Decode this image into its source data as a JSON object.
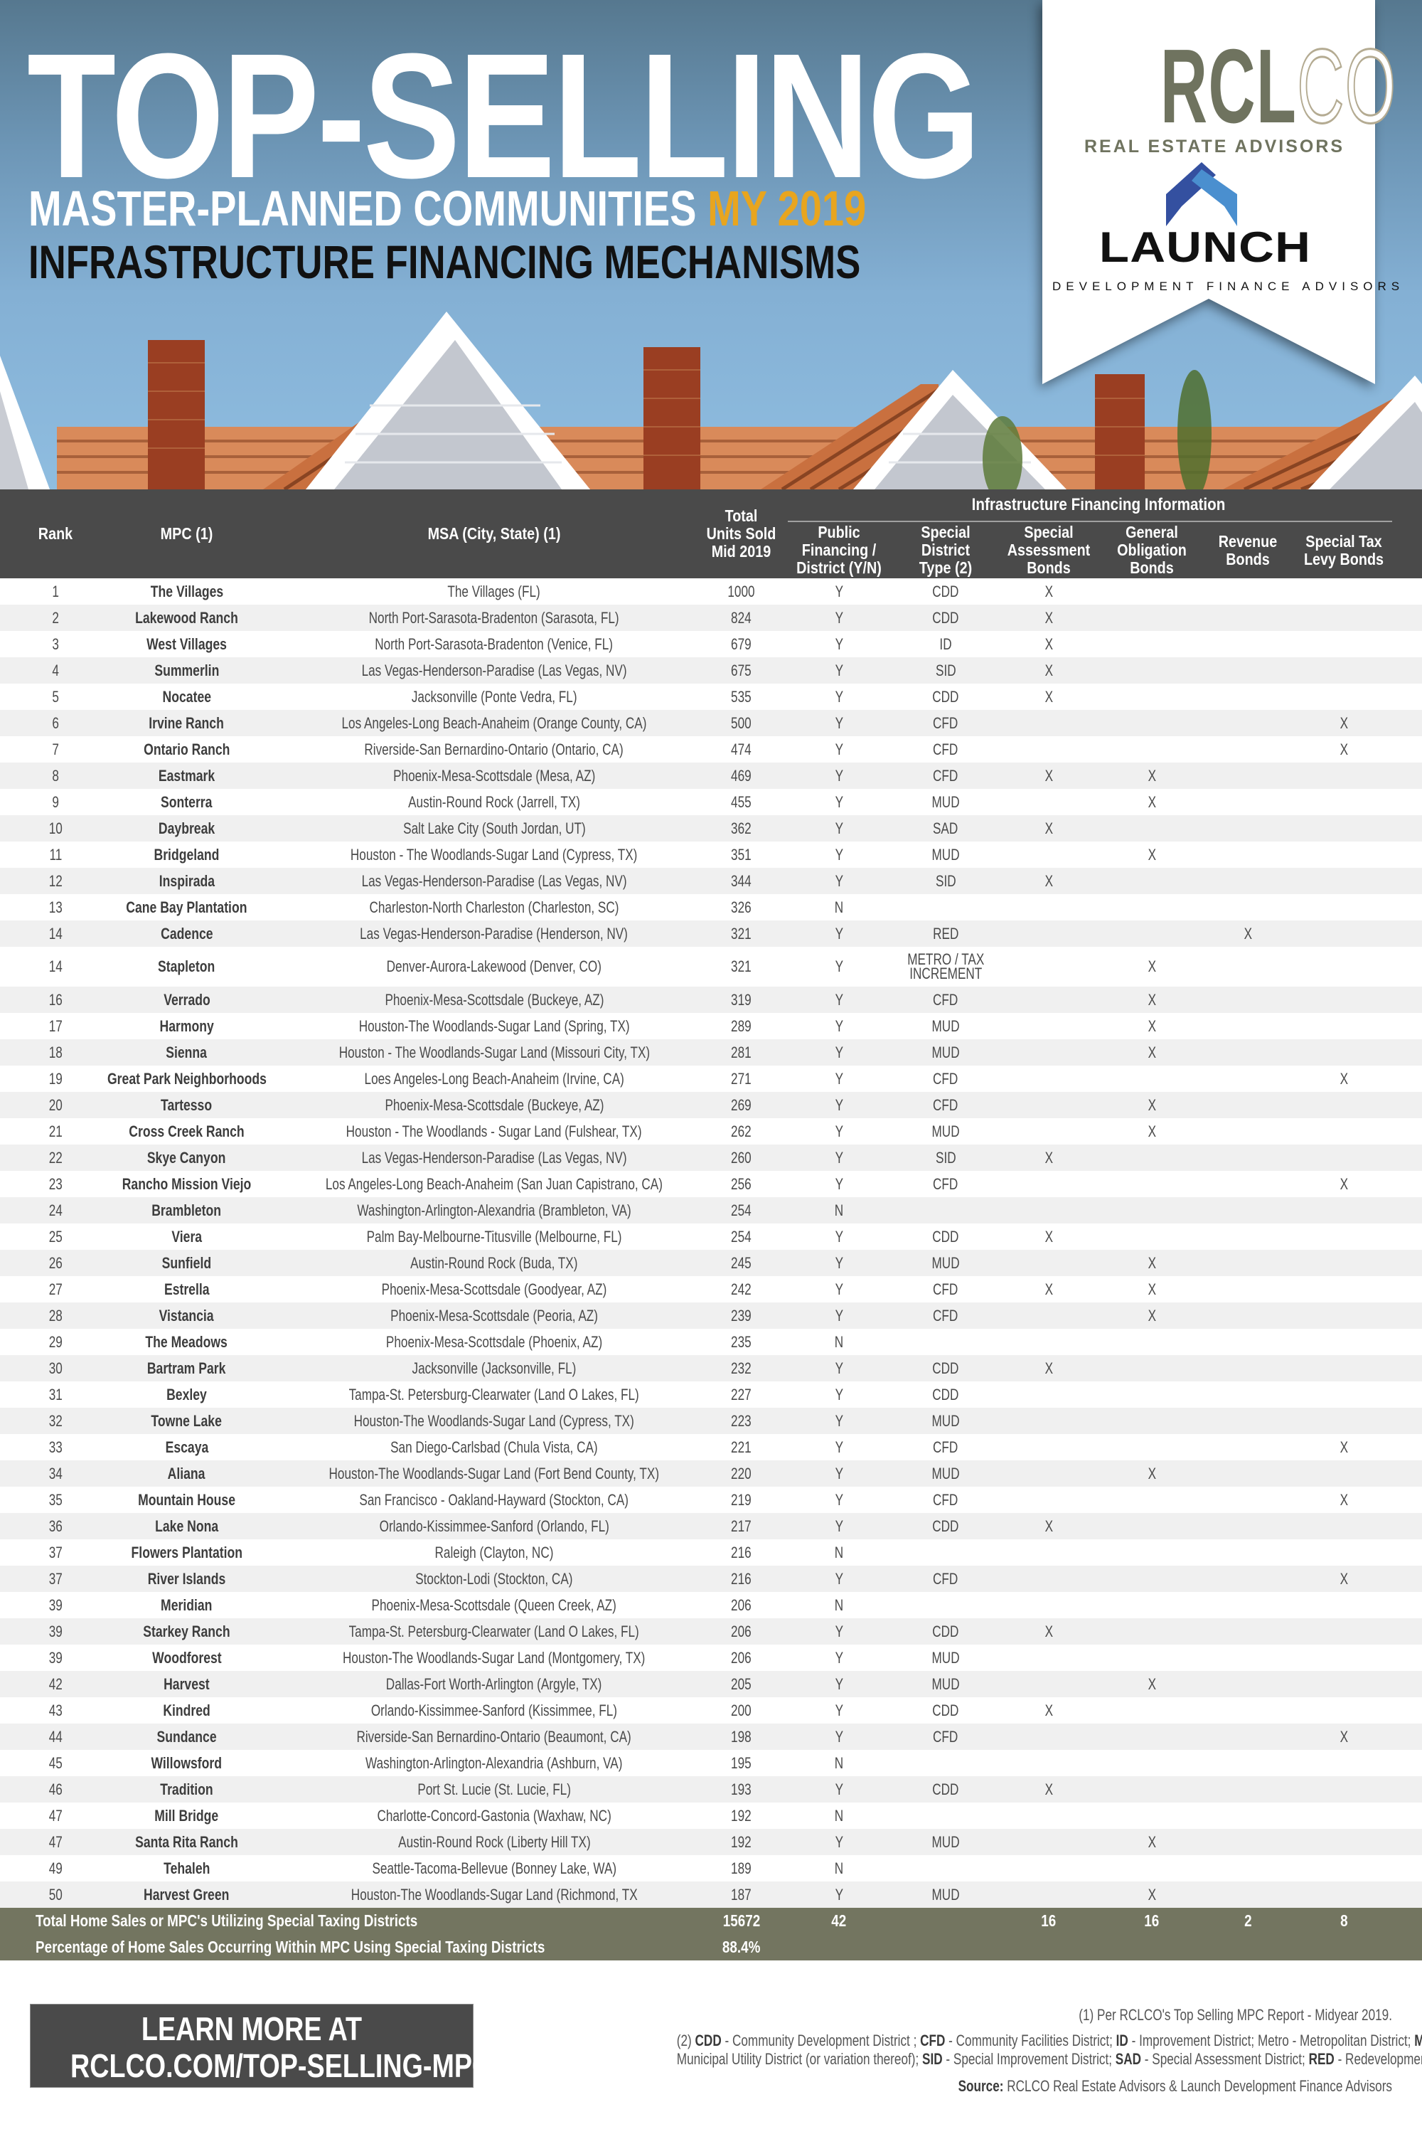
{
  "header": {
    "title": "TOP-SELLING",
    "subtitle": "MASTER-PLANNED COMMUNITIES",
    "subtitle_accent": "MY 2019",
    "subtitle2": "INFRASTRUCTURE FINANCING MECHANISMS",
    "accent_color": "#e8a51f"
  },
  "logos": {
    "rclco_solid": "RCL",
    "rclco_outline": "CO",
    "rclco_tagline": "REAL ESTATE ADVISORS",
    "launch_name": "LAUNCH",
    "launch_tagline": "DEVELOPMENT FINANCE ADVISORS"
  },
  "table": {
    "group_header": "Infrastructure Financing Information",
    "columns": {
      "rank": "Rank",
      "mpc": "MPC (1)",
      "msa": "MSA (City, State) (1)",
      "units": "Total\nUnits Sold\nMid 2019",
      "public": "Public\nFinancing /\nDistrict (Y/N)",
      "type": "Special\nDistrict\nType (2)",
      "sab": "Special\nAssessment\nBonds",
      "gob": "General\nObligation\nBonds",
      "rev": "Revenue\nBonds",
      "stl": "Special Tax\nLevy Bonds"
    },
    "rows": [
      {
        "rank": "1",
        "mpc": "The Villages",
        "msa": "The Villages (FL)",
        "units": "1000",
        "public": "Y",
        "type": "CDD",
        "sab": "X",
        "gob": "",
        "rev": "",
        "stl": ""
      },
      {
        "rank": "2",
        "mpc": "Lakewood Ranch",
        "msa": "North Port-Sarasota-Bradenton (Sarasota, FL)",
        "units": "824",
        "public": "Y",
        "type": "CDD",
        "sab": "X",
        "gob": "",
        "rev": "",
        "stl": ""
      },
      {
        "rank": "3",
        "mpc": "West Villages",
        "msa": "North Port-Sarasota-Bradenton (Venice, FL)",
        "units": "679",
        "public": "Y",
        "type": "ID",
        "sab": "X",
        "gob": "",
        "rev": "",
        "stl": ""
      },
      {
        "rank": "4",
        "mpc": "Summerlin",
        "msa": "Las Vegas-Henderson-Paradise (Las Vegas, NV)",
        "units": "675",
        "public": "Y",
        "type": "SID",
        "sab": "X",
        "gob": "",
        "rev": "",
        "stl": ""
      },
      {
        "rank": "5",
        "mpc": "Nocatee",
        "msa": "Jacksonville (Ponte Vedra, FL)",
        "units": "535",
        "public": "Y",
        "type": "CDD",
        "sab": "X",
        "gob": "",
        "rev": "",
        "stl": ""
      },
      {
        "rank": "6",
        "mpc": "Irvine Ranch",
        "msa": "Los Angeles-Long Beach-Anaheim (Orange County, CA)",
        "units": "500",
        "public": "Y",
        "type": "CFD",
        "sab": "",
        "gob": "",
        "rev": "",
        "stl": "X"
      },
      {
        "rank": "7",
        "mpc": "Ontario Ranch",
        "msa": "Riverside-San Bernardino-Ontario (Ontario, CA)",
        "units": "474",
        "public": "Y",
        "type": "CFD",
        "sab": "",
        "gob": "",
        "rev": "",
        "stl": "X"
      },
      {
        "rank": "8",
        "mpc": "Eastmark",
        "msa": "Phoenix-Mesa-Scottsdale (Mesa, AZ)",
        "units": "469",
        "public": "Y",
        "type": "CFD",
        "sab": "X",
        "gob": "X",
        "rev": "",
        "stl": ""
      },
      {
        "rank": "9",
        "mpc": "Sonterra",
        "msa": "Austin-Round Rock (Jarrell, TX)",
        "units": "455",
        "public": "Y",
        "type": "MUD",
        "sab": "",
        "gob": "X",
        "rev": "",
        "stl": ""
      },
      {
        "rank": "10",
        "mpc": "Daybreak",
        "msa": "Salt Lake City (South Jordan, UT)",
        "units": "362",
        "public": "Y",
        "type": "SAD",
        "sab": "X",
        "gob": "",
        "rev": "",
        "stl": ""
      },
      {
        "rank": "11",
        "mpc": "Bridgeland",
        "msa": "Houston - The Woodlands-Sugar Land (Cypress, TX)",
        "units": "351",
        "public": "Y",
        "type": "MUD",
        "sab": "",
        "gob": "X",
        "rev": "",
        "stl": ""
      },
      {
        "rank": "12",
        "mpc": "Inspirada",
        "msa": "Las Vegas-Henderson-Paradise (Las Vegas, NV)",
        "units": "344",
        "public": "Y",
        "type": "SID",
        "sab": "X",
        "gob": "",
        "rev": "",
        "stl": ""
      },
      {
        "rank": "13",
        "mpc": "Cane Bay Plantation",
        "msa": "Charleston-North Charleston (Charleston, SC)",
        "units": "326",
        "public": "N",
        "type": "",
        "sab": "",
        "gob": "",
        "rev": "",
        "stl": ""
      },
      {
        "rank": "14",
        "mpc": "Cadence",
        "msa": "Las Vegas-Henderson-Paradise (Henderson, NV)",
        "units": "321",
        "public": "Y",
        "type": "RED",
        "sab": "",
        "gob": "",
        "rev": "X",
        "stl": ""
      },
      {
        "rank": "14",
        "mpc": "Stapleton",
        "msa": "Denver-Aurora-Lakewood (Denver, CO)",
        "units": "321",
        "public": "Y",
        "type": "METRO / TAX\nINCREMENT",
        "sab": "",
        "gob": "X",
        "rev": "",
        "stl": ""
      },
      {
        "rank": "16",
        "mpc": "Verrado",
        "msa": "Phoenix-Mesa-Scottsdale (Buckeye, AZ)",
        "units": "319",
        "public": "Y",
        "type": "CFD",
        "sab": "",
        "gob": "X",
        "rev": "",
        "stl": ""
      },
      {
        "rank": "17",
        "mpc": "Harmony",
        "msa": "Houston-The Woodlands-Sugar Land (Spring, TX)",
        "units": "289",
        "public": "Y",
        "type": "MUD",
        "sab": "",
        "gob": "X",
        "rev": "",
        "stl": ""
      },
      {
        "rank": "18",
        "mpc": "Sienna",
        "msa": "Houston - The Woodlands-Sugar Land (Missouri City, TX)",
        "units": "281",
        "public": "Y",
        "type": "MUD",
        "sab": "",
        "gob": "X",
        "rev": "",
        "stl": ""
      },
      {
        "rank": "19",
        "mpc": "Great Park Neighborhoods",
        "msa": "Loes Angeles-Long Beach-Anaheim (Irvine, CA)",
        "units": "271",
        "public": "Y",
        "type": "CFD",
        "sab": "",
        "gob": "",
        "rev": "",
        "stl": "X"
      },
      {
        "rank": "20",
        "mpc": "Tartesso",
        "msa": "Phoenix-Mesa-Scottsdale (Buckeye, AZ)",
        "units": "269",
        "public": "Y",
        "type": "CFD",
        "sab": "",
        "gob": "X",
        "rev": "",
        "stl": ""
      },
      {
        "rank": "21",
        "mpc": "Cross Creek Ranch",
        "msa": "Houston - The Woodlands - Sugar Land (Fulshear, TX)",
        "units": "262",
        "public": "Y",
        "type": "MUD",
        "sab": "",
        "gob": "X",
        "rev": "",
        "stl": ""
      },
      {
        "rank": "22",
        "mpc": "Skye Canyon",
        "msa": "Las Vegas-Henderson-Paradise (Las Vegas, NV)",
        "units": "260",
        "public": "Y",
        "type": "SID",
        "sab": "X",
        "gob": "",
        "rev": "",
        "stl": ""
      },
      {
        "rank": "23",
        "mpc": "Rancho Mission Viejo",
        "msa": "Los Angeles-Long Beach-Anaheim (San Juan Capistrano, CA)",
        "units": "256",
        "public": "Y",
        "type": "CFD",
        "sab": "",
        "gob": "",
        "rev": "",
        "stl": "X"
      },
      {
        "rank": "24",
        "mpc": "Brambleton",
        "msa": "Washington-Arlington-Alexandria (Brambleton, VA)",
        "units": "254",
        "public": "N",
        "type": "",
        "sab": "",
        "gob": "",
        "rev": "",
        "stl": ""
      },
      {
        "rank": "25",
        "mpc": "Viera",
        "msa": "Palm Bay-Melbourne-Titusville (Melbourne, FL)",
        "units": "254",
        "public": "Y",
        "type": "CDD",
        "sab": "X",
        "gob": "",
        "rev": "",
        "stl": ""
      },
      {
        "rank": "26",
        "mpc": "Sunfield",
        "msa": "Austin-Round Rock (Buda, TX)",
        "units": "245",
        "public": "Y",
        "type": "MUD",
        "sab": "",
        "gob": "X",
        "rev": "",
        "stl": ""
      },
      {
        "rank": "27",
        "mpc": "Estrella",
        "msa": "Phoenix-Mesa-Scottsdale (Goodyear, AZ)",
        "units": "242",
        "public": "Y",
        "type": "CFD",
        "sab": "X",
        "gob": "X",
        "rev": "",
        "stl": ""
      },
      {
        "rank": "28",
        "mpc": "Vistancia",
        "msa": "Phoenix-Mesa-Scottsdale (Peoria, AZ)",
        "units": "239",
        "public": "Y",
        "type": "CFD",
        "sab": "",
        "gob": "X",
        "rev": "",
        "stl": ""
      },
      {
        "rank": "29",
        "mpc": "The Meadows",
        "msa": "Phoenix-Mesa-Scottsdale (Phoenix, AZ)",
        "units": "235",
        "public": "N",
        "type": "",
        "sab": "",
        "gob": "",
        "rev": "",
        "stl": ""
      },
      {
        "rank": "30",
        "mpc": "Bartram Park",
        "msa": "Jacksonville (Jacksonville, FL)",
        "units": "232",
        "public": "Y",
        "type": "CDD",
        "sab": "X",
        "gob": "",
        "rev": "",
        "stl": ""
      },
      {
        "rank": "31",
        "mpc": "Bexley",
        "msa": "Tampa-St. Petersburg-Clearwater (Land O Lakes, FL)",
        "units": "227",
        "public": "Y",
        "type": "CDD",
        "sab": "",
        "gob": "",
        "rev": "",
        "stl": ""
      },
      {
        "rank": "32",
        "mpc": "Towne Lake",
        "msa": "Houston-The Woodlands-Sugar Land (Cypress, TX)",
        "units": "223",
        "public": "Y",
        "type": "MUD",
        "sab": "",
        "gob": "",
        "rev": "",
        "stl": ""
      },
      {
        "rank": "33",
        "mpc": "Escaya",
        "msa": "San Diego-Carlsbad (Chula Vista, CA)",
        "units": "221",
        "public": "Y",
        "type": "CFD",
        "sab": "",
        "gob": "",
        "rev": "",
        "stl": "X"
      },
      {
        "rank": "34",
        "mpc": "Aliana",
        "msa": "Houston-The Woodlands-Sugar Land (Fort Bend County, TX)",
        "units": "220",
        "public": "Y",
        "type": "MUD",
        "sab": "",
        "gob": "X",
        "rev": "",
        "stl": ""
      },
      {
        "rank": "35",
        "mpc": "Mountain House",
        "msa": "San Francisco - Oakland-Hayward (Stockton, CA)",
        "units": "219",
        "public": "Y",
        "type": "CFD",
        "sab": "",
        "gob": "",
        "rev": "",
        "stl": "X"
      },
      {
        "rank": "36",
        "mpc": "Lake Nona",
        "msa": "Orlando-Kissimmee-Sanford (Orlando, FL)",
        "units": "217",
        "public": "Y",
        "type": "CDD",
        "sab": "X",
        "gob": "",
        "rev": "",
        "stl": ""
      },
      {
        "rank": "37",
        "mpc": "Flowers Plantation",
        "msa": "Raleigh (Clayton, NC)",
        "units": "216",
        "public": "N",
        "type": "",
        "sab": "",
        "gob": "",
        "rev": "",
        "stl": ""
      },
      {
        "rank": "37",
        "mpc": "River Islands",
        "msa": "Stockton-Lodi (Stockton, CA)",
        "units": "216",
        "public": "Y",
        "type": "CFD",
        "sab": "",
        "gob": "",
        "rev": "",
        "stl": "X"
      },
      {
        "rank": "39",
        "mpc": "Meridian",
        "msa": "Phoenix-Mesa-Scottsdale (Queen Creek, AZ)",
        "units": "206",
        "public": "N",
        "type": "",
        "sab": "",
        "gob": "",
        "rev": "",
        "stl": ""
      },
      {
        "rank": "39",
        "mpc": "Starkey Ranch",
        "msa": "Tampa-St. Petersburg-Clearwater (Land O Lakes, FL)",
        "units": "206",
        "public": "Y",
        "type": "CDD",
        "sab": "X",
        "gob": "",
        "rev": "",
        "stl": ""
      },
      {
        "rank": "39",
        "mpc": "Woodforest",
        "msa": "Houston-The Woodlands-Sugar Land (Montgomery, TX)",
        "units": "206",
        "public": "Y",
        "type": "MUD",
        "sab": "",
        "gob": "",
        "rev": "",
        "stl": ""
      },
      {
        "rank": "42",
        "mpc": "Harvest",
        "msa": "Dallas-Fort Worth-Arlington (Argyle, TX)",
        "units": "205",
        "public": "Y",
        "type": "MUD",
        "sab": "",
        "gob": "X",
        "rev": "",
        "stl": ""
      },
      {
        "rank": "43",
        "mpc": "Kindred",
        "msa": "Orlando-Kissimmee-Sanford (Kissimmee, FL)",
        "units": "200",
        "public": "Y",
        "type": "CDD",
        "sab": "X",
        "gob": "",
        "rev": "",
        "stl": ""
      },
      {
        "rank": "44",
        "mpc": "Sundance",
        "msa": "Riverside-San Bernardino-Ontario (Beaumont, CA)",
        "units": "198",
        "public": "Y",
        "type": "CFD",
        "sab": "",
        "gob": "",
        "rev": "",
        "stl": "X"
      },
      {
        "rank": "45",
        "mpc": "Willowsford",
        "msa": "Washington-Arlington-Alexandria (Ashburn, VA)",
        "units": "195",
        "public": "N",
        "type": "",
        "sab": "",
        "gob": "",
        "rev": "",
        "stl": ""
      },
      {
        "rank": "46",
        "mpc": "Tradition",
        "msa": "Port St. Lucie (St. Lucie, FL)",
        "units": "193",
        "public": "Y",
        "type": "CDD",
        "sab": "X",
        "gob": "",
        "rev": "",
        "stl": ""
      },
      {
        "rank": "47",
        "mpc": "Mill Bridge",
        "msa": "Charlotte-Concord-Gastonia (Waxhaw, NC)",
        "units": "192",
        "public": "N",
        "type": "",
        "sab": "",
        "gob": "",
        "rev": "",
        "stl": ""
      },
      {
        "rank": "47",
        "mpc": "Santa Rita Ranch",
        "msa": "Austin-Round Rock (Liberty Hill TX)",
        "units": "192",
        "public": "Y",
        "type": "MUD",
        "sab": "",
        "gob": "X",
        "rev": "",
        "stl": ""
      },
      {
        "rank": "49",
        "mpc": "Tehaleh",
        "msa": "Seattle-Tacoma-Bellevue (Bonney Lake, WA)",
        "units": "189",
        "public": "N",
        "type": "",
        "sab": "",
        "gob": "",
        "rev": "",
        "stl": ""
      },
      {
        "rank": "50",
        "mpc": "Harvest Green",
        "msa": "Houston-The Woodlands-Sugar Land (Richmond, TX",
        "units": "187",
        "public": "Y",
        "type": "MUD",
        "sab": "",
        "gob": "X",
        "rev": "",
        "stl": ""
      }
    ],
    "totals": {
      "label": "Total Home Sales or  MPC's Utilizing Special Taxing Districts",
      "units": "15672",
      "public": "42",
      "sab": "16",
      "gob": "16",
      "rev": "2",
      "stl": "8"
    },
    "percentage": {
      "label": "Percentage of Home Sales Occurring Within MPC Using Special Taxing Districts",
      "value": "88.4%"
    }
  },
  "footer": {
    "cta_line1": "LEARN MORE AT",
    "cta_line2": "RCLCO.COM/TOP-SELLING-MPCS",
    "note1": "(1)  Per RCLCO's Top Selling MPC Report - Midyear 2019.",
    "note2_parts": [
      {
        "t": "(2) ",
        "b": false
      },
      {
        "t": "CDD",
        "b": true
      },
      {
        "t": " - Community Development District ; ",
        "b": false
      },
      {
        "t": "CFD",
        "b": true
      },
      {
        "t": " - Community Facilities District; ",
        "b": false
      },
      {
        "t": "ID",
        "b": true
      },
      {
        "t": " - Improvement District;  Metro - Metropolitan District; ",
        "b": false
      },
      {
        "t": "MUD",
        "b": true
      },
      {
        "t": " -",
        "b": false
      }
    ],
    "note2b_parts": [
      {
        "t": "Municipal Utility District (or variation thereof); ",
        "b": false
      },
      {
        "t": "SID",
        "b": true
      },
      {
        "t": " - Special Improvement District; ",
        "b": false
      },
      {
        "t": "SAD",
        "b": true
      },
      {
        "t": " - Special Assessment District; ",
        "b": false
      },
      {
        "t": "RED",
        "b": true
      },
      {
        "t": " - Redevelopment Distric",
        "b": false
      }
    ],
    "source_label": "Source:",
    "source_text": " RCLCO Real Estate Advisors & Launch Development Finance Advisors"
  }
}
